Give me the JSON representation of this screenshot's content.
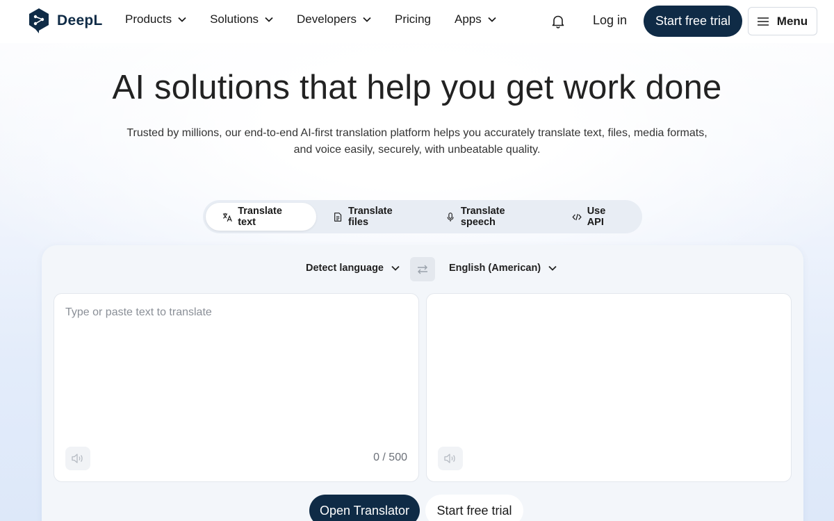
{
  "header": {
    "brand": "DeepL",
    "nav": [
      {
        "label": "Products",
        "dropdown": true
      },
      {
        "label": "Solutions",
        "dropdown": true
      },
      {
        "label": "Developers",
        "dropdown": true
      },
      {
        "label": "Pricing",
        "dropdown": false
      },
      {
        "label": "Apps",
        "dropdown": true
      }
    ],
    "login_label": "Log in",
    "trial_label": "Start free trial",
    "menu_label": "Menu"
  },
  "hero": {
    "title": "AI solutions that help you get work done",
    "subtitle": "Trusted by millions, our end-to-end AI-first translation platform helps you accurately translate text, files, media formats, and voice easily, securely, with unbeatable quality."
  },
  "tabs": [
    {
      "label": "Translate text",
      "icon": "translate-icon",
      "active": true
    },
    {
      "label": "Translate files",
      "icon": "file-icon",
      "active": false
    },
    {
      "label": "Translate speech",
      "icon": "microphone-icon",
      "active": false
    },
    {
      "label": "Use API",
      "icon": "code-icon",
      "active": false
    }
  ],
  "translator": {
    "source_language": "Detect language",
    "target_language": "English (American)",
    "input_placeholder": "Type or paste text to translate",
    "char_counter": "0 / 500"
  },
  "cta": {
    "open_label": "Open Translator",
    "trial_label": "Start free trial"
  },
  "colors": {
    "brand_navy": "#0f2b46",
    "tab_bar_bg": "#e8edf4",
    "card_bg": "#f3f6fa"
  }
}
